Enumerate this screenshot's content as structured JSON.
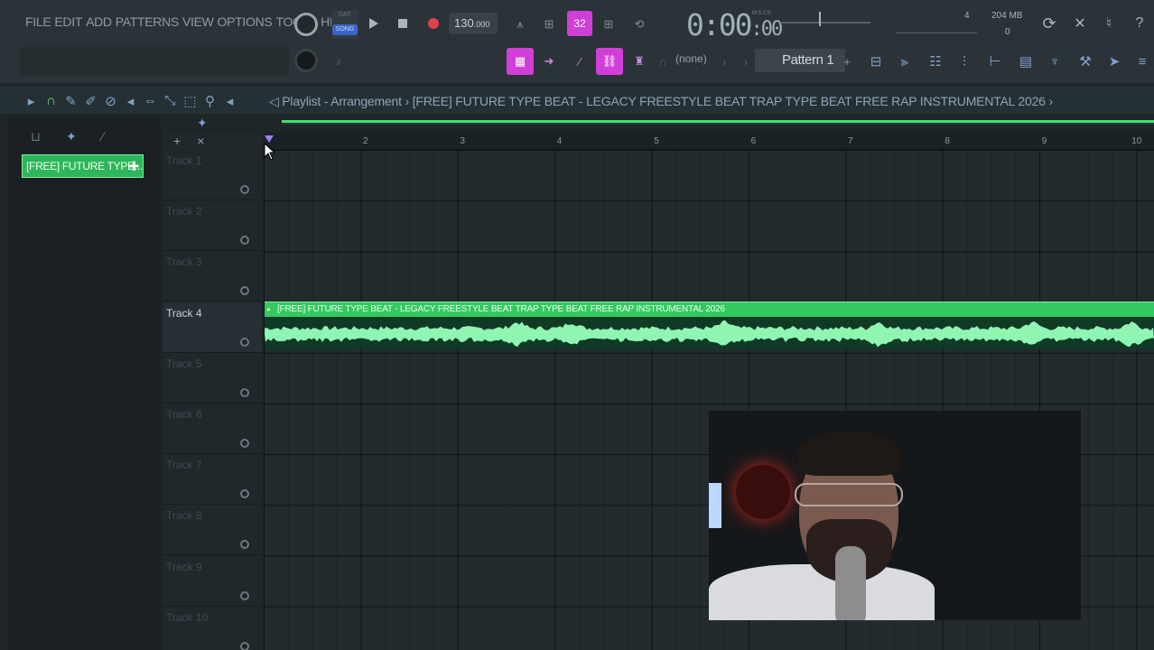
{
  "menu": [
    "FILE",
    "EDIT",
    "ADD",
    "PATTERNS",
    "VIEW",
    "OPTIONS",
    "TOOLS",
    "HELP"
  ],
  "transport": {
    "mode_top": "DAT",
    "mode_label": "SONG",
    "tempo_main": "130",
    "tempo_frac": ".000",
    "time_main": "0:00",
    "time_frac": ":00",
    "time_unit": "M:S:CS"
  },
  "snap_value": "32",
  "cpu": {
    "memory": "204 MB",
    "polyphony": "4",
    "voices": "0"
  },
  "channel_selector": "(none)",
  "pattern_selector": "Pattern 1",
  "playlist": {
    "title": "Playlist - Arrangement",
    "breadcrumb_sep": "›",
    "project": "[FREE] FUTURE TYPE BEAT - LEGACY  FREESTYLE BEAT  TRAP TYPE BEAT  FREE RAP INSTRUMENTAL 2026"
  },
  "picker": {
    "clip_label": "[FREE] FUTURE TYPE..."
  },
  "ruler": [
    "2",
    "3",
    "4",
    "5",
    "6",
    "7",
    "8",
    "9",
    "10"
  ],
  "tracks": [
    {
      "name": "Track 1",
      "active": false
    },
    {
      "name": "Track 2",
      "active": false
    },
    {
      "name": "Track 3",
      "active": false
    },
    {
      "name": "Track 4",
      "active": true
    },
    {
      "name": "Track 5",
      "active": false
    },
    {
      "name": "Track 6",
      "active": false
    },
    {
      "name": "Track 7",
      "active": false
    },
    {
      "name": "Track 8",
      "active": false
    },
    {
      "name": "Track 9",
      "active": false
    },
    {
      "name": "Track 10",
      "active": false
    }
  ],
  "clip": {
    "label": "[FREE] FUTURE TYPE BEAT - LEGACY  FREESTYLE BEAT  TRAP TYPE BEAT  FREE RAP INSTRUMENTAL 2026",
    "color": "#34c960",
    "wave_color": "#8ff5b2"
  }
}
